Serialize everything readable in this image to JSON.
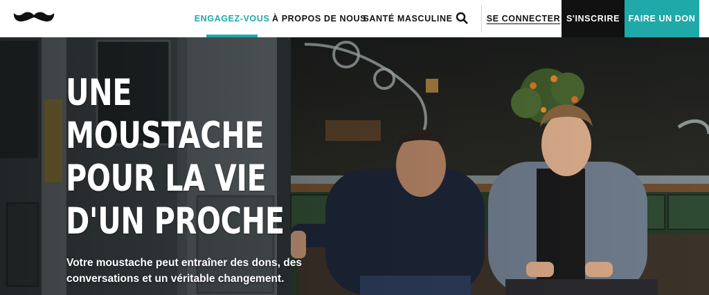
{
  "header": {
    "logo_icon": "moustache-logo-icon",
    "nav": [
      {
        "label": "ENGAGEZ-VOUS",
        "active": true
      },
      {
        "label": "À PROPOS DE NOUS",
        "active": false
      },
      {
        "label": "SANTÉ MASCULINE",
        "active": false
      }
    ],
    "search_icon": "search-icon",
    "login_label": "SE CONNECTER",
    "signup_label": "S'INSCRIRE",
    "donate_label": "FAIRE UN DON"
  },
  "hero": {
    "title_lines": [
      "UNE",
      "MOUSTACHE",
      "POUR LA VIE",
      "D'UN PROCHE"
    ],
    "subtitle": "Votre moustache peut entraîner des dons, des conversations et un véritable changement."
  },
  "colors": {
    "accent": "#20a9a9",
    "signup_bg": "#111111",
    "text_dark": "#111111"
  }
}
